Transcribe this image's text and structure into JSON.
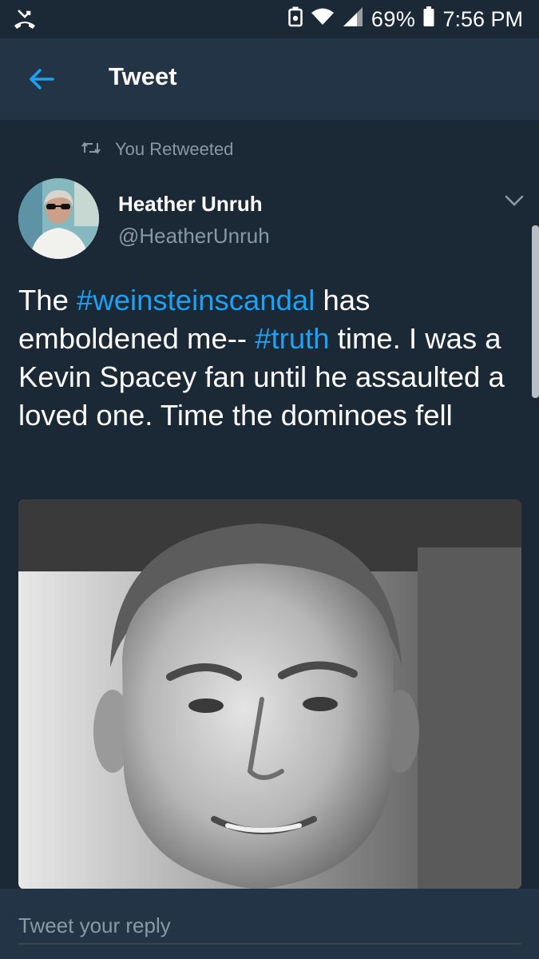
{
  "status_bar": {
    "battery_percent": "69%",
    "time": "7:56 PM",
    "icons": [
      "missed-call-icon",
      "battery-saver-icon",
      "wifi-icon",
      "signal-icon",
      "battery-icon"
    ]
  },
  "header": {
    "title": "Tweet",
    "back_icon": "back-arrow-icon"
  },
  "tweet": {
    "retweet_label": "You Retweeted",
    "author_name": "Heather Unruh",
    "author_handle": "@HeatherUnruh",
    "text_parts": {
      "p1": "The ",
      "tag1": "#weinsteinscandal",
      "p2": " has emboldened me-- ",
      "tag2": "#truth",
      "p3": " time.  I was a Kevin Spacey fan until he assaulted a loved one.  Time the dominoes fell"
    },
    "media_description": "black-and-white-portrait-photo"
  },
  "reply": {
    "placeholder": "Tweet your reply"
  },
  "colors": {
    "background": "#1b2836",
    "appbar": "#243447",
    "link": "#1da1f2",
    "secondary_text": "#8899a6"
  }
}
